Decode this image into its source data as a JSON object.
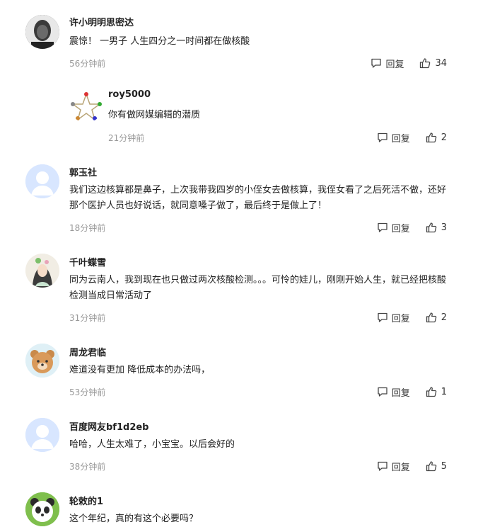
{
  "comments": [
    {
      "username": "许小明明思密达",
      "text": "震惊！ 一男子 人生四分之一时间都在做核酸",
      "time": "56分钟前",
      "reply_label": "回复",
      "likes": "34",
      "avatar_icon": "user-photo-avatar",
      "reply": {
        "username": "roy5000",
        "text": "你有做网媒编辑的潜质",
        "time": "21分钟前",
        "reply_label": "回复",
        "likes": "2",
        "avatar_icon": "pentagram-avatar"
      }
    },
    {
      "username": "郭玉社",
      "text": "我们这边核算都是鼻子，上次我带我四岁的小侄女去做核算，我侄女看了之后死活不做，还好那个医护人员也好说话，就同意嗓子做了，最后终于是做上了！",
      "time": "18分钟前",
      "reply_label": "回复",
      "likes": "3",
      "avatar_icon": "default-user-avatar"
    },
    {
      "username": "千叶蝶雪",
      "text": "同为云南人，我到现在也只做过两次核酸检测。。。可怜的娃儿，刚刚开始人生，就已经把核酸检测当成日常活动了",
      "time": "31分钟前",
      "reply_label": "回复",
      "likes": "2",
      "avatar_icon": "illustration-avatar"
    },
    {
      "username": "周龙君临",
      "text": "难道没有更加 降低成本的办法吗，",
      "time": "53分钟前",
      "reply_label": "回复",
      "likes": "1",
      "avatar_icon": "bear-avatar"
    },
    {
      "username": "百度网友bf1d2eb",
      "text": "哈哈，人生太难了，小宝宝。以后会好的",
      "time": "38分钟前",
      "reply_label": "回复",
      "likes": "5",
      "avatar_icon": "default-user-avatar"
    },
    {
      "username": "轮敕的1",
      "text": "这个年纪，真的有这个必要吗？",
      "avatar_icon": "panda-avatar"
    }
  ],
  "colors": {
    "text": "#222222",
    "meta": "#999999",
    "avatar_default_bg": "#d8e6ff"
  }
}
